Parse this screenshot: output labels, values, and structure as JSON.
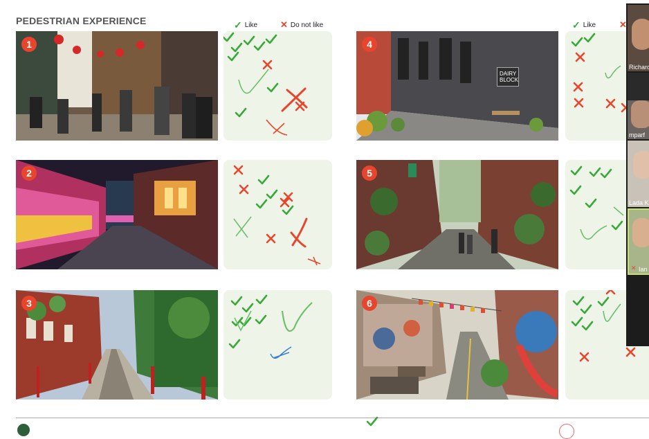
{
  "slide": {
    "title": "PEDESTRIAN EXPERIENCE",
    "legend_like": "Like",
    "legend_dislike": "Do not like",
    "legend_like_right": "Like",
    "sign_text": "DAIRY BLOCK",
    "photos": [
      {
        "number": "1"
      },
      {
        "number": "2"
      },
      {
        "number": "3"
      },
      {
        "number": "4"
      },
      {
        "number": "5"
      },
      {
        "number": "6"
      }
    ]
  },
  "participants": [
    {
      "name": "Richard"
    },
    {
      "name": "mparf"
    },
    {
      "name": "Lada K"
    },
    {
      "name": "Ian"
    }
  ],
  "colors": {
    "like_green": "#3aa83a",
    "dislike_red": "#e8452c",
    "pad_bg": "#eef5e8",
    "pen_blue": "#3b7fd6"
  }
}
